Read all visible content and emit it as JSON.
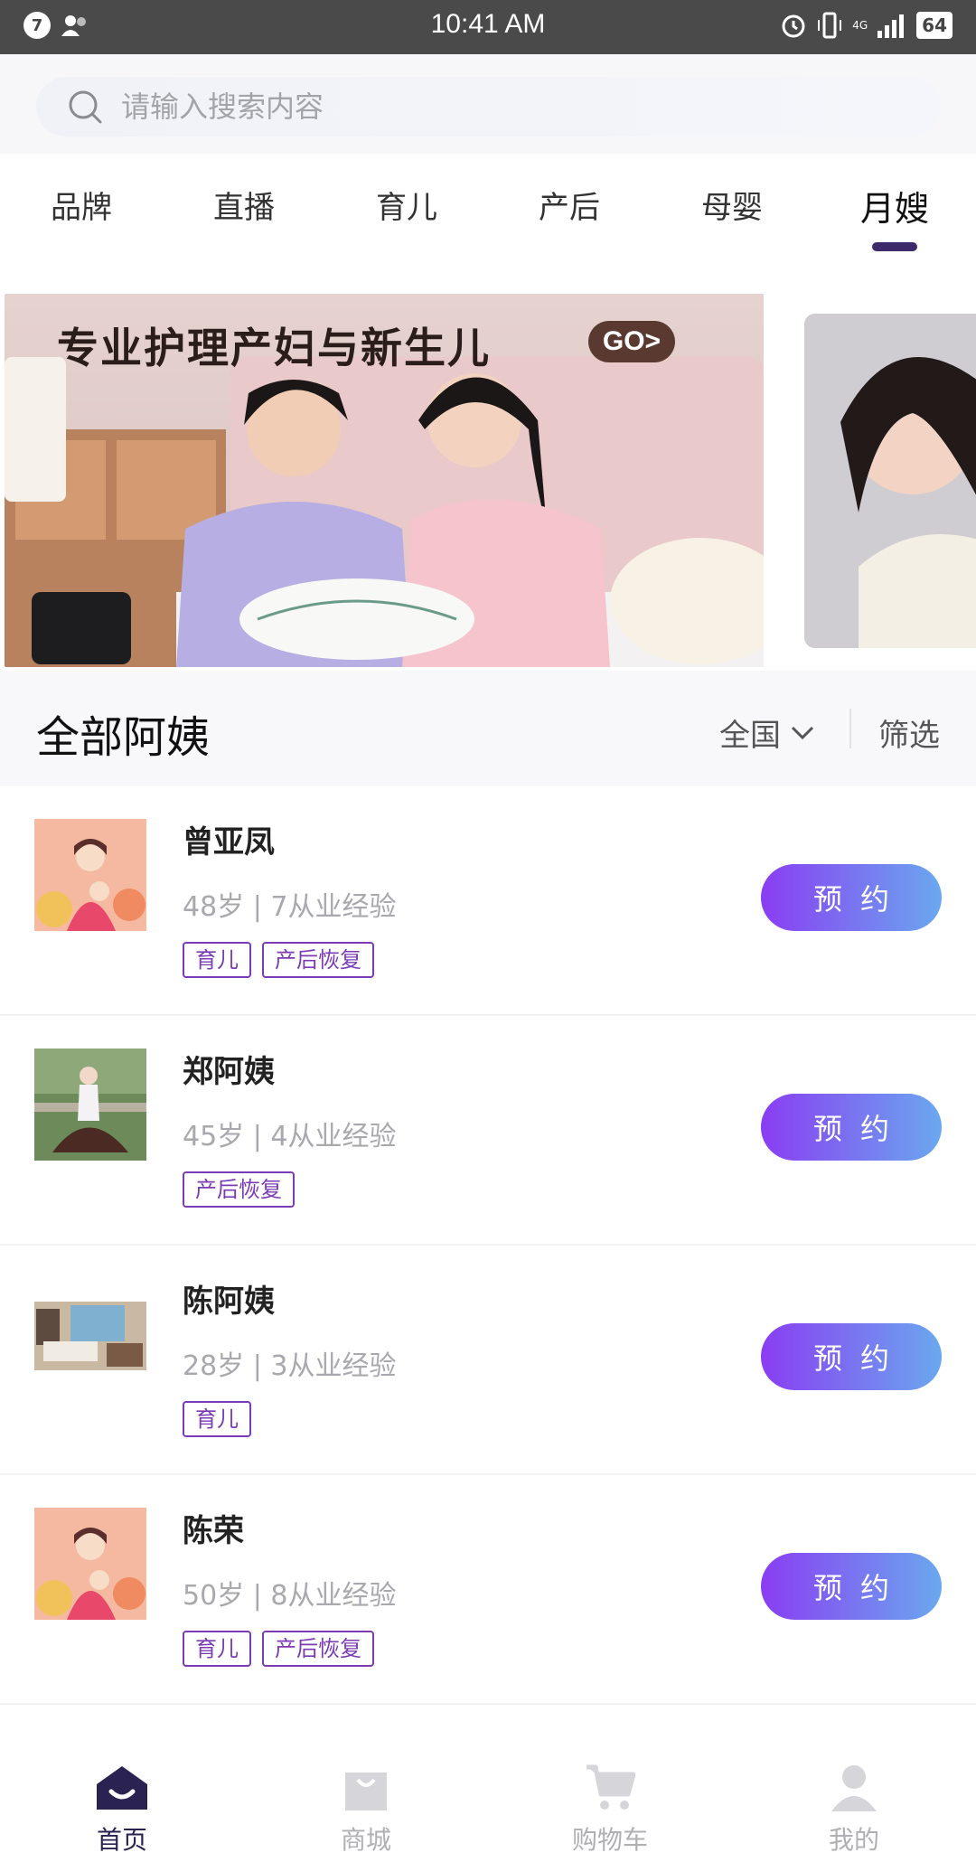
{
  "status_bar": {
    "notification_count": "7",
    "time": "10:41 AM",
    "network": "4G",
    "battery": "64"
  },
  "search": {
    "placeholder": "请输入搜索内容"
  },
  "tabs": [
    {
      "label": "品牌",
      "active": false
    },
    {
      "label": "直播",
      "active": false
    },
    {
      "label": "育儿",
      "active": false
    },
    {
      "label": "产后",
      "active": false
    },
    {
      "label": "母婴",
      "active": false
    },
    {
      "label": "月嫂",
      "active": true
    }
  ],
  "banner": {
    "title": "专业护理产妇与新生儿",
    "go_label": "GO>"
  },
  "section": {
    "title": "全部阿姨",
    "region": "全国",
    "filter": "筛选"
  },
  "nannies": [
    {
      "name": "曾亚凤",
      "meta": "48岁 | 7从业经验",
      "tags": [
        "育儿",
        "产后恢复"
      ],
      "button": "预约"
    },
    {
      "name": "郑阿姨",
      "meta": "45岁 | 4从业经验",
      "tags": [
        "产后恢复"
      ],
      "button": "预约"
    },
    {
      "name": "陈阿姨",
      "meta": "28岁 | 3从业经验",
      "tags": [
        "育儿"
      ],
      "button": "预约"
    },
    {
      "name": "陈荣",
      "meta": "50岁 | 8从业经验",
      "tags": [
        "育儿",
        "产后恢复"
      ],
      "button": "预约"
    }
  ],
  "bottom_nav": [
    {
      "label": "首页",
      "icon": "home-icon",
      "active": true
    },
    {
      "label": "商城",
      "icon": "shopping-bag-icon",
      "active": false
    },
    {
      "label": "购物车",
      "icon": "cart-icon",
      "active": false
    },
    {
      "label": "我的",
      "icon": "profile-icon",
      "active": false
    }
  ],
  "colors": {
    "accent": "#7a3bb5",
    "nav_active": "#2a2250",
    "button_gradient_start": "#8a3df2",
    "button_gradient_end": "#6aa8ef"
  }
}
